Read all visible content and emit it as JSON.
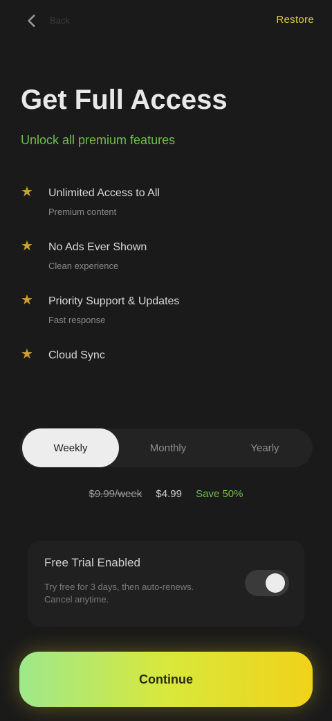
{
  "header": {
    "back_label": "",
    "top_left_text": "Back",
    "restore_label": "Restore"
  },
  "title": "Get Full Access",
  "subtitle": "Unlock all premium features",
  "features": [
    {
      "title": "Unlimited Access to All",
      "desc": "Premium content"
    },
    {
      "title": "No Ads Ever Shown",
      "desc": "Clean experience"
    },
    {
      "title": "Priority Support & Updates",
      "desc": "Fast response"
    },
    {
      "title": "Cloud Sync",
      "desc": ""
    }
  ],
  "plans": {
    "tabs": [
      "Weekly",
      "Monthly",
      "Yearly"
    ],
    "active_index": 0
  },
  "pricing": {
    "old": "$9.99/week",
    "main": "$4.99",
    "save": "Save 50%"
  },
  "trial": {
    "title": "Free Trial Enabled",
    "desc": "Try free for 3 days, then auto-renews. Cancel anytime.",
    "enabled": true
  },
  "cta_label": "Continue",
  "colors": {
    "accent_green": "#6fbf4a",
    "accent_yellow": "#f0d21a",
    "star": "#c9a132",
    "background": "#1a1a1a"
  }
}
